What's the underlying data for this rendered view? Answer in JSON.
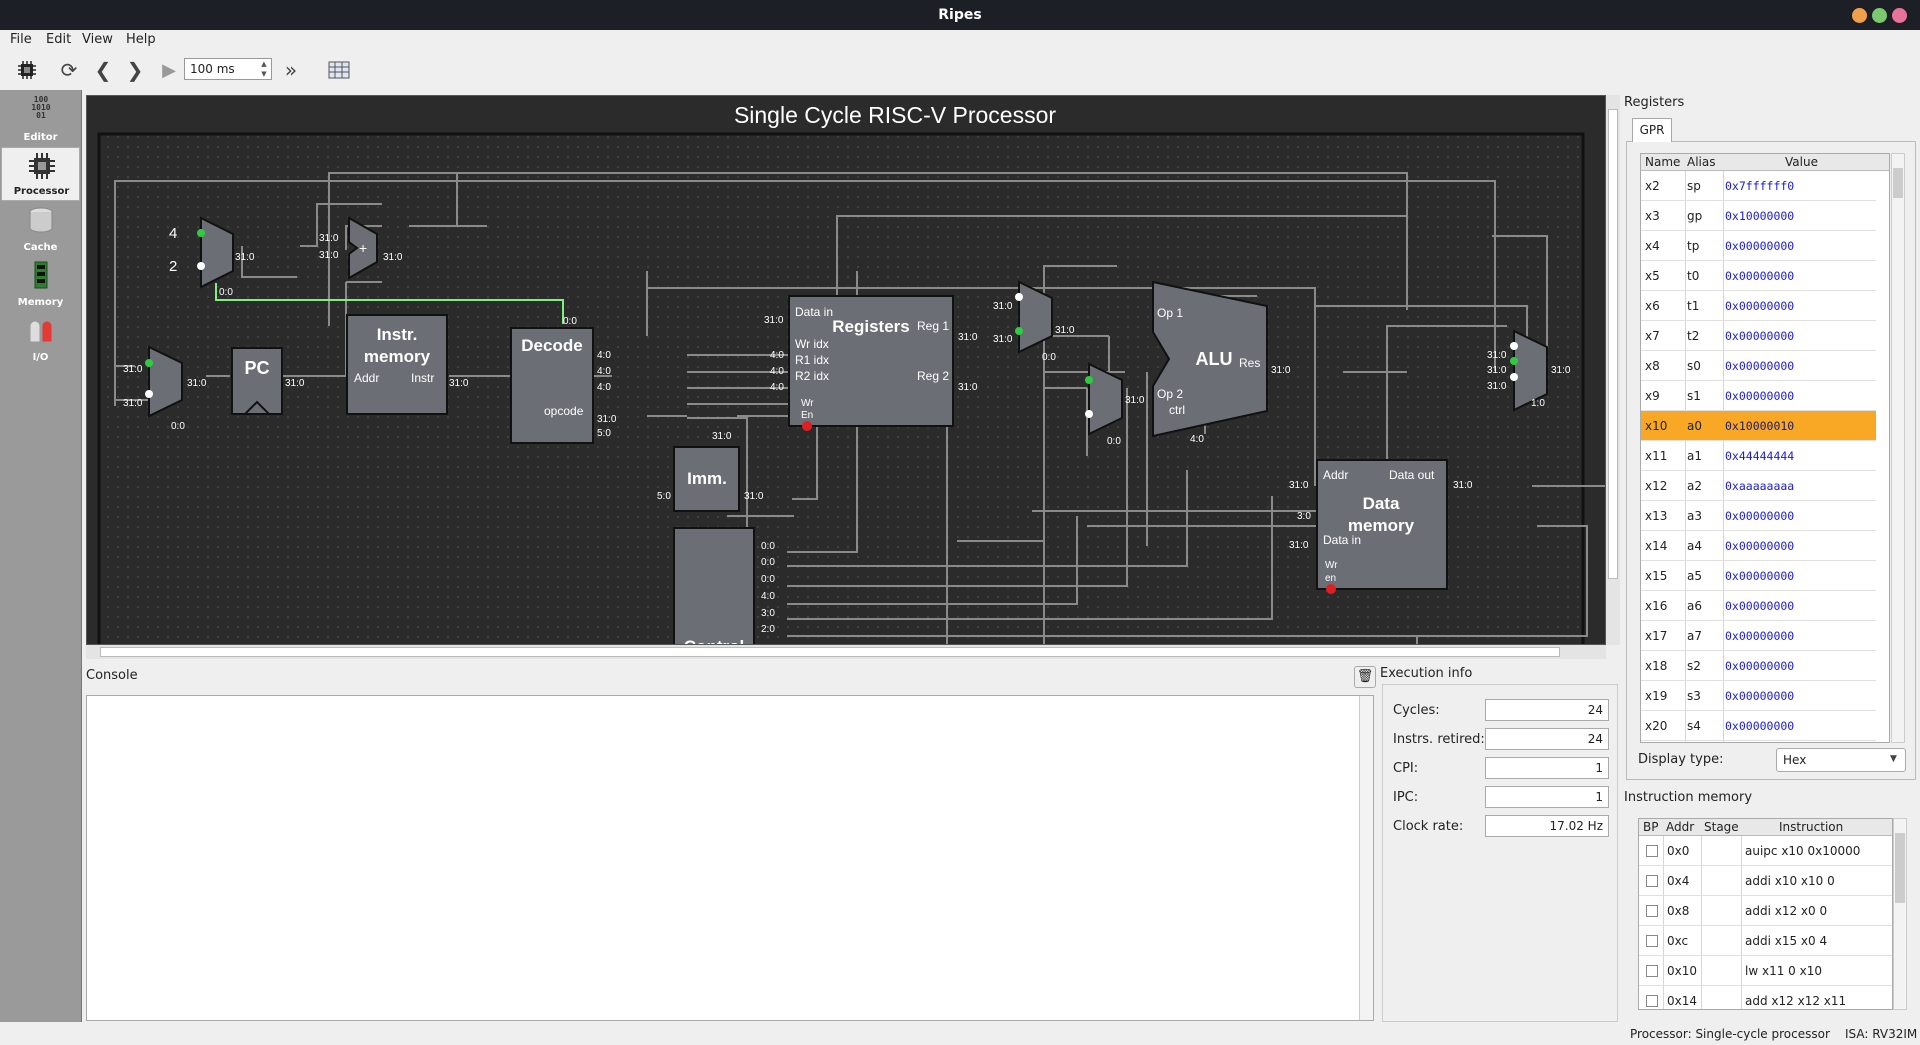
{
  "window": {
    "title": "Ripes"
  },
  "menu": [
    "File",
    "Edit",
    "View",
    "Help"
  ],
  "toolbar": {
    "speed": "100 ms"
  },
  "sidebar": {
    "items": [
      {
        "label": "Editor",
        "icon": "binary-icon"
      },
      {
        "label": "Processor",
        "icon": "chip-icon"
      },
      {
        "label": "Cache",
        "icon": "database-icon"
      },
      {
        "label": "Memory",
        "icon": "ram-icon"
      },
      {
        "label": "I/O",
        "icon": "led-icon"
      }
    ]
  },
  "diagram": {
    "title": "Single Cycle RISC-V Processor",
    "labels": {
      "four": "4",
      "two": "2",
      "plus": "+",
      "pc": "PC",
      "instr_mem_l1": "Instr.",
      "instr_mem_l2": "memory",
      "addr": "Addr",
      "instr": "Instr",
      "decode": "Decode",
      "opcode": "opcode",
      "registers": "Registers",
      "data_in": "Data in",
      "wr_idx": "Wr idx",
      "r1_idx": "R1 idx",
      "r2_idx": "R2 idx",
      "wr": "Wr",
      "en": "En",
      "reg1": "Reg 1",
      "reg2": "Reg 2",
      "imm": "Imm.",
      "alu": "ALU",
      "op1": "Op 1",
      "op2": "Op 2",
      "ctrl": "ctrl",
      "res": "Res",
      "dmem_l1": "Data",
      "dmem_l2": "memory",
      "dmem_addr": "Addr",
      "data_out": "Data out",
      "dmem_data_in": "Data in",
      "dmem_wr": "Wr",
      "dmem_en": "en",
      "control": "Control"
    },
    "bus": {
      "b31_0": "31:0",
      "b0_0": "0:0",
      "b4_0": "4:0",
      "b5_0": "5:0",
      "b3_0": "3:0",
      "b2_0": "2:0",
      "b1_0": "1:0"
    }
  },
  "console": {
    "label": "Console",
    "content": ""
  },
  "execution_info": {
    "label": "Execution info",
    "rows": [
      {
        "label": "Cycles:",
        "value": "24"
      },
      {
        "label": "Instrs. retired:",
        "value": "24"
      },
      {
        "label": "CPI:",
        "value": "1"
      },
      {
        "label": "IPC:",
        "value": "1"
      },
      {
        "label": "Clock rate:",
        "value": "17.02 Hz"
      }
    ]
  },
  "registers": {
    "label": "Registers",
    "tab": "GPR",
    "columns": [
      "Name",
      "Alias",
      "Value"
    ],
    "rows": [
      {
        "name": "x2",
        "alias": "sp",
        "value": "0x7ffffff0"
      },
      {
        "name": "x3",
        "alias": "gp",
        "value": "0x10000000"
      },
      {
        "name": "x4",
        "alias": "tp",
        "value": "0x00000000"
      },
      {
        "name": "x5",
        "alias": "t0",
        "value": "0x00000000"
      },
      {
        "name": "x6",
        "alias": "t1",
        "value": "0x00000000"
      },
      {
        "name": "x7",
        "alias": "t2",
        "value": "0x00000000"
      },
      {
        "name": "x8",
        "alias": "s0",
        "value": "0x00000000"
      },
      {
        "name": "x9",
        "alias": "s1",
        "value": "0x00000000"
      },
      {
        "name": "x10",
        "alias": "a0",
        "value": "0x10000010"
      },
      {
        "name": "x11",
        "alias": "a1",
        "value": "0x44444444"
      },
      {
        "name": "x12",
        "alias": "a2",
        "value": "0xaaaaaaaa"
      },
      {
        "name": "x13",
        "alias": "a3",
        "value": "0x00000000"
      },
      {
        "name": "x14",
        "alias": "a4",
        "value": "0x00000000"
      },
      {
        "name": "x15",
        "alias": "a5",
        "value": "0x00000000"
      },
      {
        "name": "x16",
        "alias": "a6",
        "value": "0x00000000"
      },
      {
        "name": "x17",
        "alias": "a7",
        "value": "0x00000000"
      },
      {
        "name": "x18",
        "alias": "s2",
        "value": "0x00000000"
      },
      {
        "name": "x19",
        "alias": "s3",
        "value": "0x00000000"
      },
      {
        "name": "x20",
        "alias": "s4",
        "value": "0x00000000"
      }
    ],
    "highlight_color": "#f9a825",
    "display_type_label": "Display type:",
    "display_type": "Hex"
  },
  "instruction_memory": {
    "label": "Instruction memory",
    "columns": [
      "BP",
      "Addr",
      "Stage",
      "Instruction"
    ],
    "rows": [
      {
        "addr": "0x0",
        "stage": "",
        "instr": "auipc x10 0x10000"
      },
      {
        "addr": "0x4",
        "stage": "",
        "instr": "addi x10 x10 0"
      },
      {
        "addr": "0x8",
        "stage": "",
        "instr": "addi x12 x0 0"
      },
      {
        "addr": "0xc",
        "stage": "",
        "instr": "addi x15 x0 4"
      },
      {
        "addr": "0x10",
        "stage": "",
        "instr": "lw x11 0 x10"
      },
      {
        "addr": "0x14",
        "stage": "",
        "instr": "add x12 x12 x11"
      }
    ]
  },
  "statusbar": {
    "processor": "Processor: Single-cycle processor",
    "isa": "ISA: RV32IM"
  }
}
